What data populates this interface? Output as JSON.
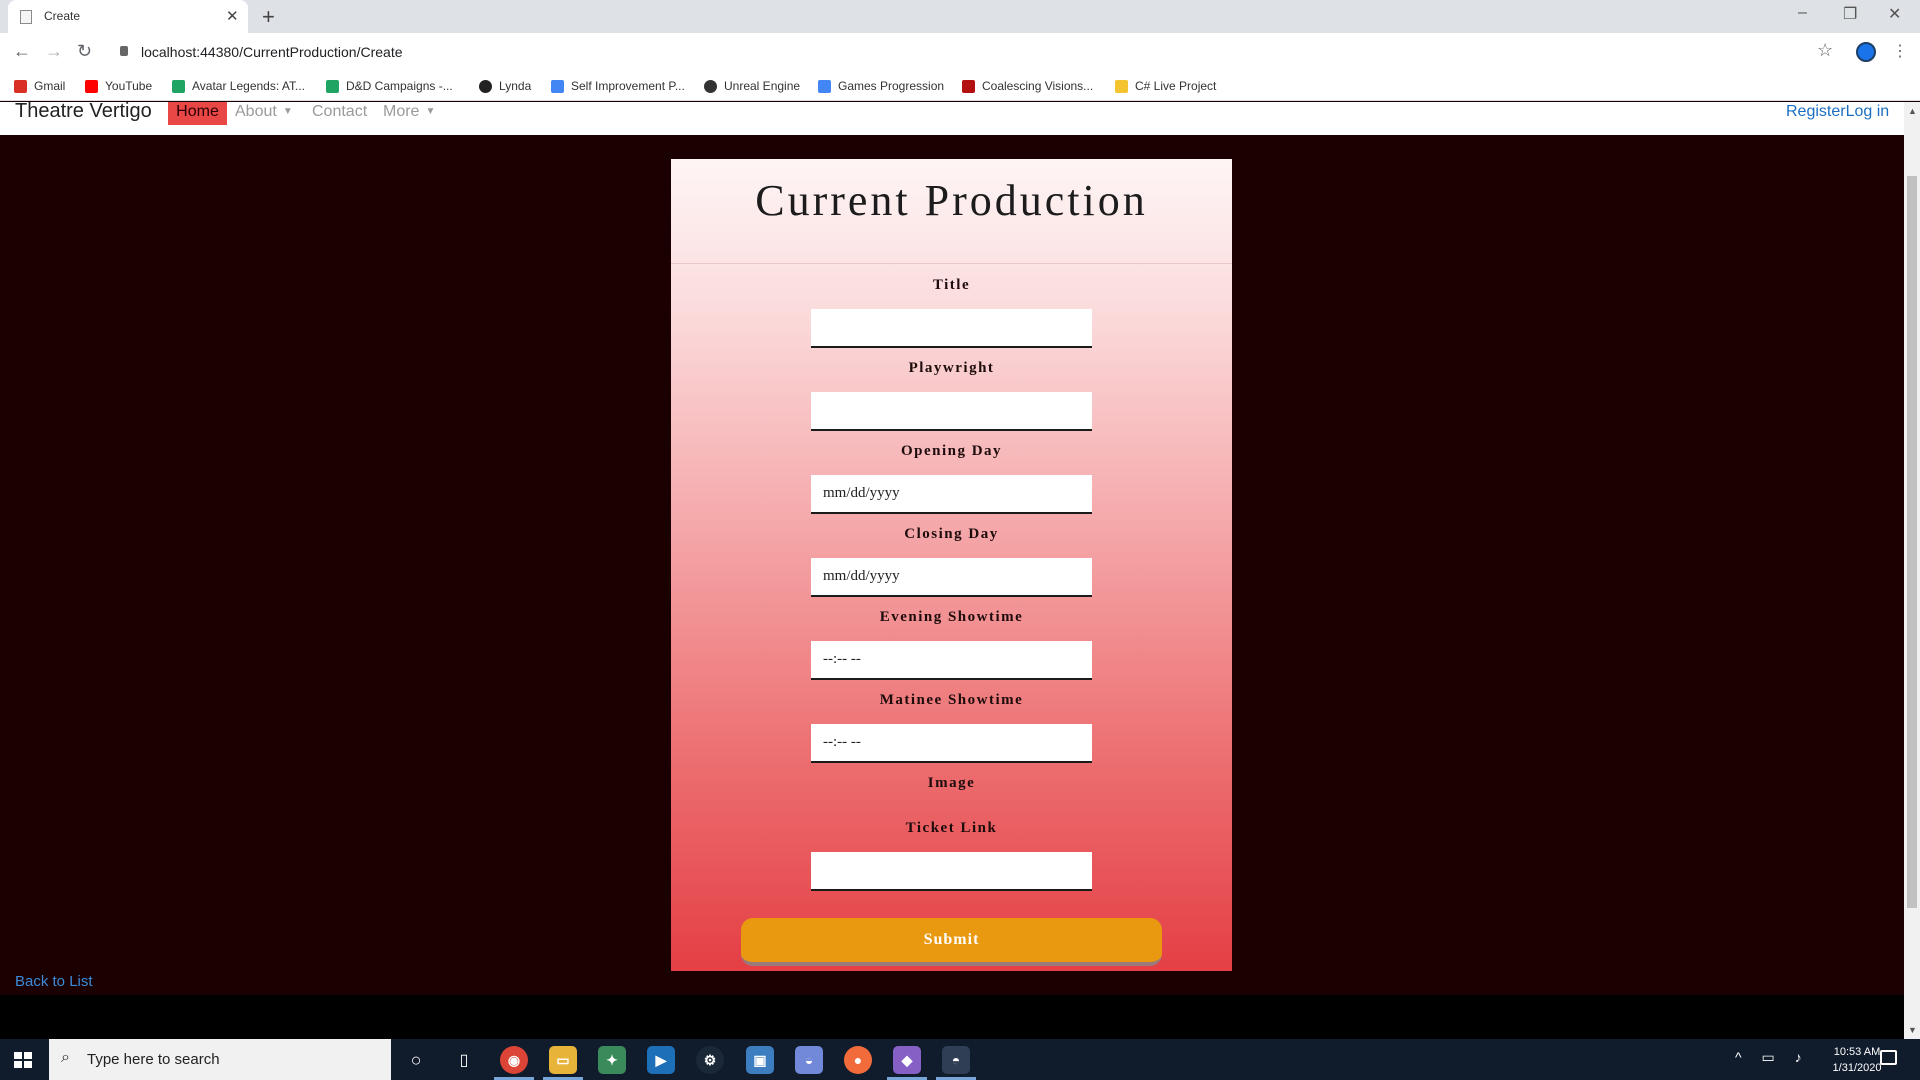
{
  "browser": {
    "tab_title": "Create",
    "url": "localhost:44380/CurrentProduction/Create",
    "bookmarks": [
      {
        "label": "Gmail",
        "color": "#d93025"
      },
      {
        "label": "YouTube",
        "color": "#ff0000"
      },
      {
        "label": "Avatar Legends: AT...",
        "color": "#1fa463"
      },
      {
        "label": "D&D Campaigns -...",
        "color": "#1fa463"
      },
      {
        "label": "Lynda",
        "color": "#222222"
      },
      {
        "label": "Self Improvement P...",
        "color": "#4285f4"
      },
      {
        "label": "Unreal Engine",
        "color": "#333333"
      },
      {
        "label": "Games Progression",
        "color": "#4285f4"
      },
      {
        "label": "Coalescing Visions...",
        "color": "#b31010"
      },
      {
        "label": "C# Live Project",
        "color": "#f4c430"
      }
    ]
  },
  "site_nav": {
    "brand": "Theatre Vertigo",
    "home": "Home",
    "about": "About",
    "contact": "Contact",
    "more": "More",
    "register_login": "RegisterLog in"
  },
  "form": {
    "heading": "Current Production",
    "title_label": "Title",
    "playwright_label": "Playwright",
    "opening_day_label": "Opening Day",
    "opening_day_placeholder": "mm/dd/yyyy",
    "closing_day_label": "Closing Day",
    "closing_day_placeholder": "mm/dd/yyyy",
    "evening_showtime_label": "Evening Showtime",
    "evening_showtime_placeholder": "--:-- --",
    "matinee_showtime_label": "Matinee Showtime",
    "matinee_showtime_placeholder": "--:-- --",
    "image_label": "Image",
    "ticket_link_label": "Ticket Link",
    "submit": "Submit"
  },
  "back_link": "Back to List",
  "taskbar": {
    "search_placeholder": "Type here to search",
    "time": "10:53 AM",
    "date": "1/31/2020"
  },
  "colors": {
    "page_background": "#1a0000",
    "home_active": "#e94646",
    "submit_button": "#e8990f",
    "link": "#3b8bd9"
  }
}
